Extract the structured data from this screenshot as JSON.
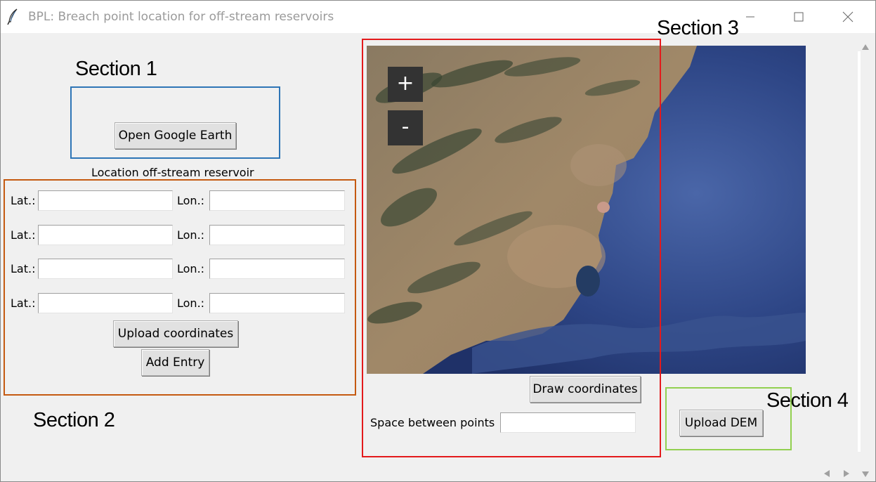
{
  "window": {
    "title": "BPL: Breach point location for off-stream reservoirs",
    "icon": "feather-icon",
    "controls": [
      "minimize-icon",
      "maximize-icon",
      "close-icon"
    ]
  },
  "annotations": {
    "section1": "Section 1",
    "section2": "Section 2",
    "section3": "Section 3",
    "section4": "Section 4",
    "colors": {
      "section1": "#2e75b6",
      "section2": "#c55a11",
      "section3": "#e31a1c",
      "section4": "#92d050"
    }
  },
  "section1": {
    "open_google_earth": "Open Google Earth"
  },
  "section2": {
    "heading": "Location off-stream reservoir",
    "rows": [
      {
        "lat_label": "Lat.:",
        "lat_value": "",
        "lon_label": "Lon.:",
        "lon_value": ""
      },
      {
        "lat_label": "Lat.:",
        "lat_value": "",
        "lon_label": "Lon.:",
        "lon_value": ""
      },
      {
        "lat_label": "Lat.:",
        "lat_value": "",
        "lon_label": "Lon.:",
        "lon_value": ""
      },
      {
        "lat_label": "Lat.:",
        "lat_value": "",
        "lon_label": "Lon.:",
        "lon_value": ""
      }
    ],
    "upload_coordinates": "Upload coordinates",
    "add_entry": "Add Entry"
  },
  "section3": {
    "zoom_in": "+",
    "zoom_out": "-",
    "draw_coordinates": "Draw coordinates",
    "space_label": "Space between points",
    "space_value": ""
  },
  "section4": {
    "upload_dem": "Upload DEM"
  },
  "scrollbar_icons": [
    "scroll-up-icon",
    "scroll-down-icon",
    "scroll-left-icon",
    "scroll-right-icon"
  ]
}
